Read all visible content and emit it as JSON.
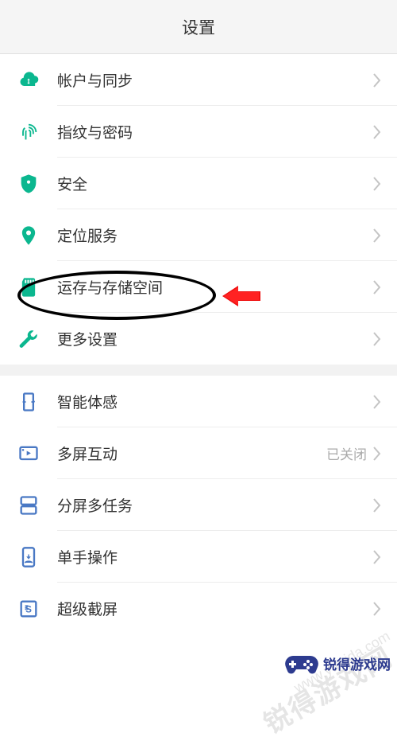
{
  "header": {
    "title": "设置"
  },
  "groupA": [
    {
      "label": "帐户与同步",
      "icon": "cloud-sync",
      "detail": ""
    },
    {
      "label": "指纹与密码",
      "icon": "fingerprint",
      "detail": ""
    },
    {
      "label": "安全",
      "icon": "shield",
      "detail": ""
    },
    {
      "label": "定位服务",
      "icon": "location-pin",
      "detail": ""
    },
    {
      "label": "运存与存储空间",
      "icon": "sd-card",
      "detail": ""
    },
    {
      "label": "更多设置",
      "icon": "wrench",
      "detail": ""
    }
  ],
  "groupB": [
    {
      "label": "智能体感",
      "icon": "gesture",
      "detail": ""
    },
    {
      "label": "多屏互动",
      "icon": "multiscreen",
      "detail": "已关闭"
    },
    {
      "label": "分屏多任务",
      "icon": "split-screen",
      "detail": ""
    },
    {
      "label": "单手操作",
      "icon": "one-hand",
      "detail": ""
    },
    {
      "label": "超级截屏",
      "icon": "screenshot",
      "detail": ""
    }
  ],
  "accent": "#0bb78f",
  "iconAccent": "#0bb78f",
  "iconBlue": "#4978c4",
  "watermark": {
    "name": "锐得游戏网",
    "url": "www.ytruida.com"
  },
  "badgeText": "锐得游戏网"
}
